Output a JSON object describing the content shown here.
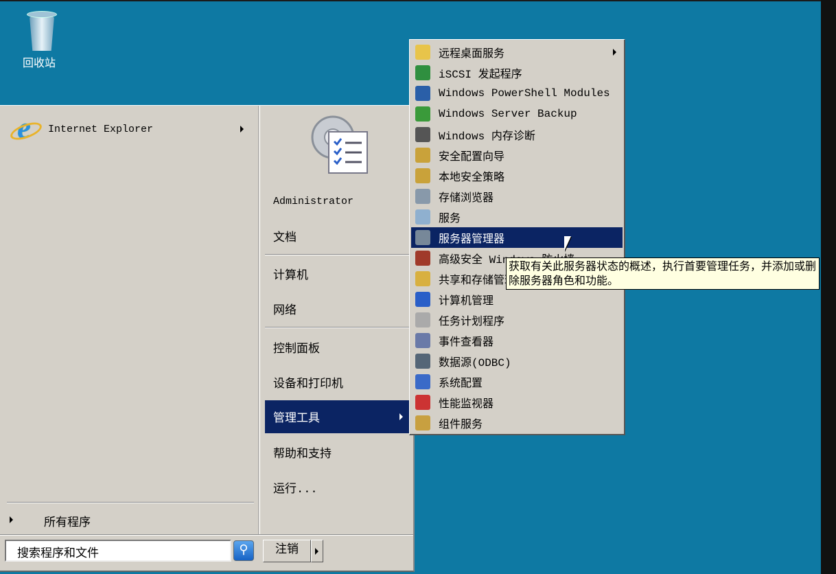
{
  "desktop": {
    "recycle_bin_label": "回收站"
  },
  "start_menu": {
    "pinned": [
      {
        "label": "Internet Explorer",
        "icon": "internet-explorer-icon"
      }
    ],
    "all_programs": "所有程序",
    "search_placeholder": "搜索程序和文件",
    "logoff_label": "注销",
    "right_items": [
      {
        "label": "Administrator"
      },
      {
        "label": "文档"
      },
      {
        "label": "计算机"
      },
      {
        "label": "网络"
      },
      {
        "label": "控制面板"
      },
      {
        "label": "设备和打印机"
      },
      {
        "label": "管理工具"
      },
      {
        "label": "帮助和支持"
      },
      {
        "label": "运行..."
      }
    ]
  },
  "admin_tools_menu": {
    "items": [
      {
        "label": "远程桌面服务",
        "icon": "folder-icon",
        "color": "#e8c44a"
      },
      {
        "label": "iSCSI 发起程序",
        "icon": "globe-icon",
        "color": "#2f8f3f"
      },
      {
        "label": "Windows PowerShell Modules",
        "icon": "powershell-icon",
        "color": "#2a5fa8"
      },
      {
        "label": "Windows Server Backup",
        "icon": "backup-icon",
        "color": "#3a9a3a"
      },
      {
        "label": "Windows 内存诊断",
        "icon": "memory-icon",
        "color": "#555555"
      },
      {
        "label": "安全配置向导",
        "icon": "security-wizard-icon",
        "color": "#c9a23a"
      },
      {
        "label": "本地安全策略",
        "icon": "security-policy-icon",
        "color": "#c9a23a"
      },
      {
        "label": "存储浏览器",
        "icon": "storage-icon",
        "color": "#8899aa"
      },
      {
        "label": "服务",
        "icon": "gear-icon",
        "color": "#8fb0cf"
      },
      {
        "label": "服务器管理器",
        "icon": "server-manager-icon",
        "color": "#778899"
      },
      {
        "label": "高级安全 Windows 防火墙",
        "icon": "firewall-icon",
        "color": "#a03a2a"
      },
      {
        "label": "共享和存储管理",
        "icon": "share-icon",
        "color": "#d8b040"
      },
      {
        "label": "计算机管理",
        "icon": "computer-management-icon",
        "color": "#2a5fc8"
      },
      {
        "label": "任务计划程序",
        "icon": "clock-icon",
        "color": "#aaaaaa"
      },
      {
        "label": "事件查看器",
        "icon": "event-viewer-icon",
        "color": "#6a7aa8"
      },
      {
        "label": "数据源(ODBC)",
        "icon": "odbc-icon",
        "color": "#556677"
      },
      {
        "label": "系统配置",
        "icon": "system-config-icon",
        "color": "#3a6ac8"
      },
      {
        "label": "性能监视器",
        "icon": "performance-icon",
        "color": "#cc3333"
      },
      {
        "label": "组件服务",
        "icon": "component-icon",
        "color": "#c8a040"
      }
    ],
    "tooltip": "获取有关此服务器状态的概述，执行首要管理任务，并添加或删除服务器角色和功能。"
  }
}
